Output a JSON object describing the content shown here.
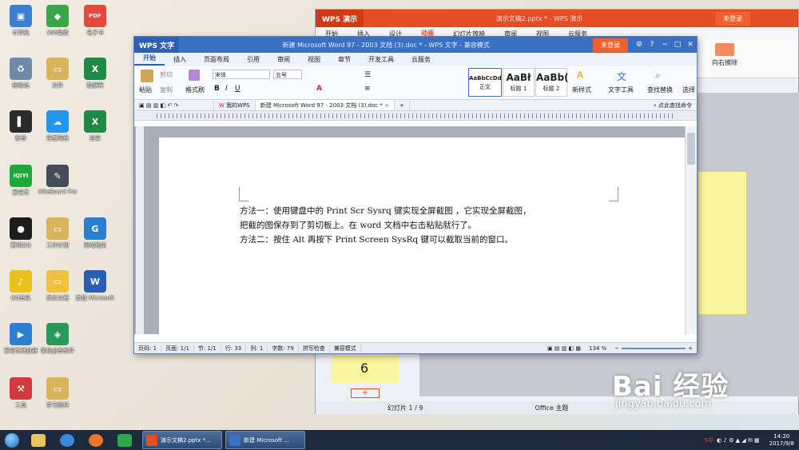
{
  "desktop": {
    "icons": [
      {
        "label": "计算机",
        "color": "#3b7fd4"
      },
      {
        "label": "回收站",
        "color": "#6e8aa8"
      },
      {
        "label": "影音",
        "color": "#2b2b2b"
      },
      {
        "label": "爱奇艺",
        "color": "#1fa83a"
      },
      {
        "label": "腾讯QQ",
        "color": "#1d1d1d"
      },
      {
        "label": "QQ音乐",
        "color": "#e8c21a"
      },
      {
        "label": "爱奇艺播放器",
        "color": "#2a7fd1"
      },
      {
        "label": "工具",
        "color": "#d13a3a"
      },
      {
        "label": "文件",
        "color": "#d8b45c"
      },
      {
        "label": "360免费",
        "color": "#3aa64a"
      },
      {
        "label": "百度网盘",
        "color": "#2296f3"
      },
      {
        "label": "HiteBoard Pro",
        "color": "#444c58"
      },
      {
        "label": "工作计划",
        "color": "#d8b45c"
      },
      {
        "label": "演示文稿",
        "color": "#f0c040"
      },
      {
        "label": "装机必备软件",
        "color": "#2a9a5a"
      },
      {
        "label": "学习资料",
        "color": "#d8b45c"
      },
      {
        "label": "电子书",
        "color": "#e04a3a"
      },
      {
        "label": "数据表",
        "color": "#1e8a45"
      },
      {
        "label": "目录",
        "color": "#1e8a45"
      },
      {
        "label": "驱动精灵",
        "color": "#2a7fd1"
      },
      {
        "label": "新建 Microsoft",
        "color": "#2b5eb7"
      }
    ]
  },
  "ppt": {
    "logo": "WPS 演示",
    "title": "演示文稿2.pptx * - WPS 演示",
    "login": "未登录",
    "menu": [
      "开始",
      "插入",
      "设计",
      "动画",
      "幻灯片放映",
      "审阅",
      "视图",
      "云服务"
    ],
    "ribbon_right": "向右擦除",
    "thumb_number": "6",
    "add_slide": "+",
    "status_slide": "幻灯片 1 / 9",
    "status_theme": "Office 主题",
    "slide_color": "#fbf59d"
  },
  "wps": {
    "logo": "WPS 文字",
    "title": "新建 Microsoft Word 97 - 2003 文档 (3).doc * - WPS 文字 - 兼容模式",
    "login": "未登录",
    "controls": [
      "⚙",
      "?",
      "−",
      "□",
      "✕"
    ],
    "menu": [
      "开始",
      "插入",
      "页面布局",
      "引用",
      "审阅",
      "视图",
      "章节",
      "开发工具",
      "云服务"
    ],
    "ribbon": {
      "paste": "粘贴",
      "cut": "剪切",
      "copy": "复制",
      "format_painter": "格式刷",
      "font": "宋体",
      "size": "五号",
      "styles": [
        {
          "preview": "AaBbCcDd",
          "name": "正文"
        },
        {
          "preview": "AaBł",
          "name": "标题 1"
        },
        {
          "preview": "AaBb(",
          "name": "标题 2"
        }
      ],
      "new_style": "新样式",
      "text_tools": "文字工具",
      "find_replace": "查找替换",
      "select": "选择"
    },
    "tabs": {
      "mywps": "我的WPS",
      "doc": "新建 Microsoft Word 97 - 2003 文档 (3).doc *",
      "new": "+",
      "search": "点此查找命令"
    },
    "content": {
      "line1": "方法一：使用键盘中的 Print Scr Sysrq 键实现全屏截图 ，它实现全屏截图，",
      "line2": "把截的图保存到了剪切板上。在 word 文档中右击粘贴就行了。",
      "line3": "方法二：按住 Alt 再按下 Print Screen SysRq 键可以截取当前的窗口。"
    },
    "status": {
      "page": "页码: 1",
      "pages": "页面: 1/1",
      "section": "节: 1/1",
      "line": "行: 33",
      "col": "列: 1",
      "words": "字数: 79",
      "spell": "拼写检查",
      "mode": "兼容模式",
      "zoom": "134 %"
    },
    "accent": "#3b6fc4"
  },
  "taskbar": {
    "tasks": [
      {
        "label": "演示文稿2.pptx *...",
        "color": "#e44d26"
      },
      {
        "label": "新建 Microsoft ...",
        "color": "#3b6fc4"
      }
    ],
    "tray_text": "S中",
    "time": "14:20",
    "date": "2017/9/8"
  },
  "watermark": {
    "main": "Bai 经验",
    "sub": "jingyan.baidu.com"
  }
}
